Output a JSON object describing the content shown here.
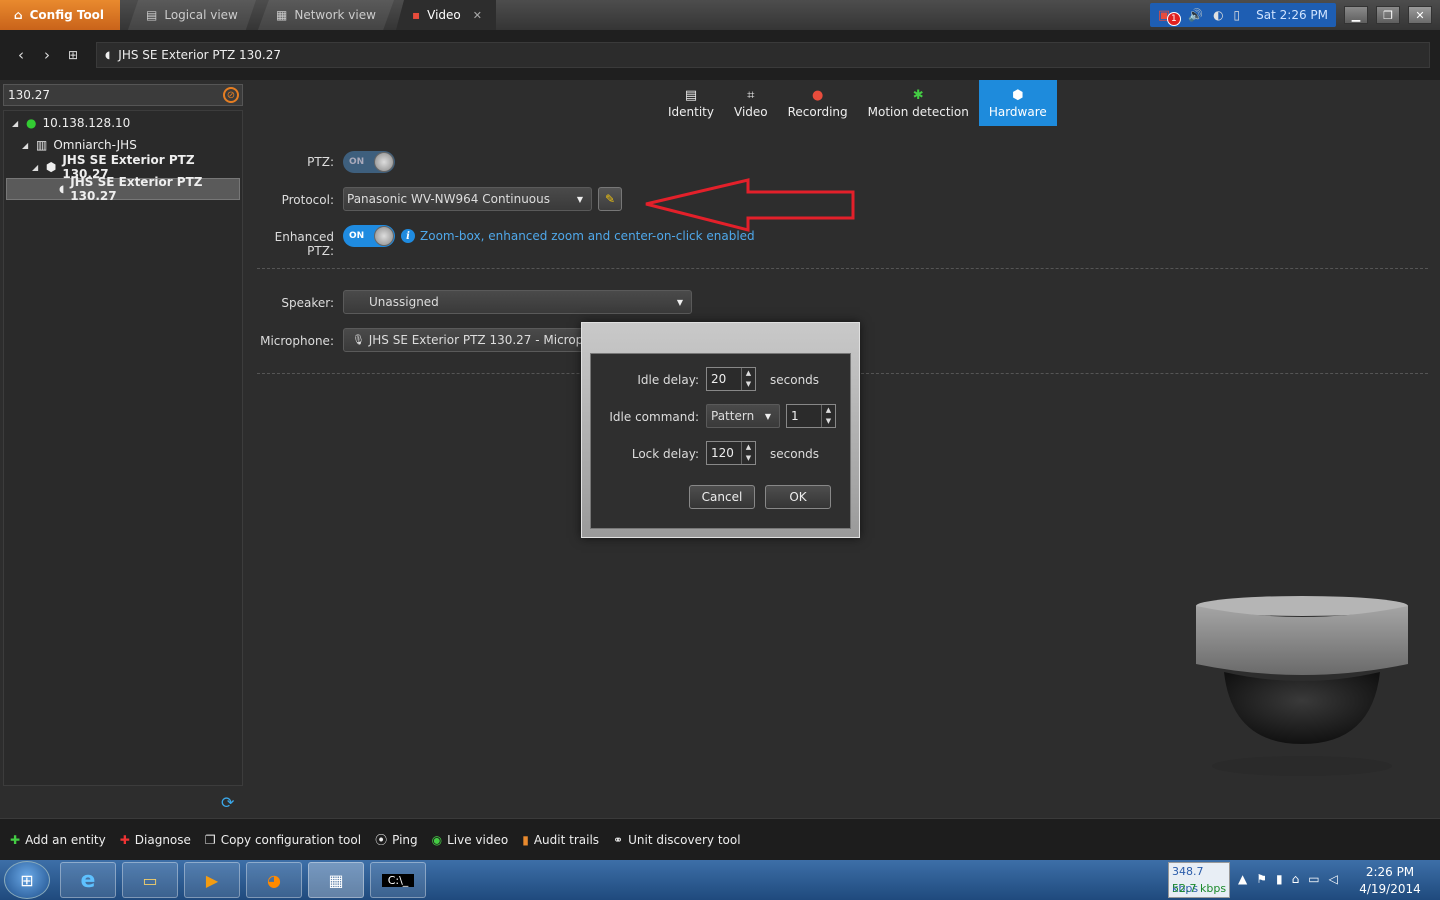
{
  "tabs": {
    "config_tool": "Config Tool",
    "logical_view": "Logical view",
    "network_view": "Network view",
    "video": "Video",
    "close": "✕"
  },
  "tray": {
    "badge": "1",
    "datetime": "Sat 2:26 PM"
  },
  "address": {
    "path": "JHS SE Exterior PTZ 130.27"
  },
  "search": {
    "value": "130.27"
  },
  "tree": [
    {
      "label": "10.138.128.10"
    },
    {
      "label": "Omniarch-JHS"
    },
    {
      "label": "JHS SE Exterior PTZ 130.27"
    },
    {
      "label": "JHS SE Exterior PTZ 130.27"
    }
  ],
  "hw_tabs": [
    {
      "label": "Identity"
    },
    {
      "label": "Video"
    },
    {
      "label": "Recording"
    },
    {
      "label": "Motion detection"
    },
    {
      "label": "Hardware"
    }
  ],
  "form": {
    "ptz_label": "PTZ:",
    "ptz_toggle": "ON",
    "protocol_label": "Protocol:",
    "protocol_value": "Panasonic WV-NW964 Continuous",
    "enhanced_label": "Enhanced PTZ:",
    "enhanced_toggle": "ON",
    "enhanced_note": "Zoom-box, enhanced zoom and center-on-click enabled",
    "speaker_label": "Speaker:",
    "speaker_value": "Unassigned",
    "microphone_label": "Microphone:",
    "microphone_value": "JHS SE Exterior PTZ 130.27 - Microphone"
  },
  "dialog": {
    "idle_delay_label": "Idle delay:",
    "idle_delay_value": "20",
    "idle_delay_unit": "seconds",
    "idle_command_label": "Idle command:",
    "idle_command_value": "Pattern",
    "idle_command_number": "1",
    "lock_delay_label": "Lock delay:",
    "lock_delay_value": "120",
    "lock_delay_unit": "seconds",
    "cancel": "Cancel",
    "ok": "OK"
  },
  "toolbar": [
    {
      "label": "Add an entity"
    },
    {
      "label": "Diagnose"
    },
    {
      "label": "Copy configuration tool"
    },
    {
      "label": "Ping"
    },
    {
      "label": "Live video"
    },
    {
      "label": "Audit trails"
    },
    {
      "label": "Unit discovery tool"
    }
  ],
  "taskbar": {
    "kbps_down": "348.7 kbps",
    "kbps_up": "52.7 kbps",
    "time": "2:26 PM",
    "date": "4/19/2014"
  },
  "colors": {
    "accent": "#1f8be0",
    "config_tab": "#d9752a",
    "annotation_arrow": "#e3202a"
  }
}
